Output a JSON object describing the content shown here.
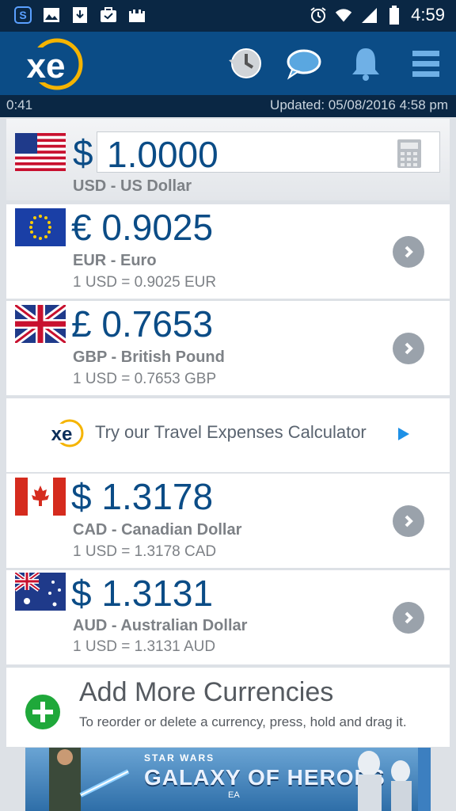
{
  "status_bar": {
    "time": "4:59",
    "left_icons": [
      "s-app-icon",
      "image-icon",
      "download-icon",
      "briefcase-icon",
      "castle-icon"
    ],
    "right_icons": [
      "alarm-icon",
      "wifi-icon",
      "signal-icon",
      "battery-icon"
    ]
  },
  "app_bar": {
    "logo": "xe",
    "icons": [
      "history-icon",
      "chat-icon",
      "bell-icon",
      "menu-icon"
    ]
  },
  "update_strip": {
    "elapsed": "0:41",
    "updated": "Updated:  05/08/2016 4:58 pm"
  },
  "base_currency": {
    "symbol": "$",
    "amount": "1.0000",
    "name": "USD - US Dollar"
  },
  "currencies": [
    {
      "symbol": "€",
      "amount": "0.9025",
      "name": "EUR - Euro",
      "rate": "1 USD = 0.9025 EUR"
    },
    {
      "symbol": "£",
      "amount": "0.7653",
      "name": "GBP - British Pound",
      "rate": "1 USD = 0.7653 GBP"
    },
    {
      "symbol": "$",
      "amount": "1.3178",
      "name": "CAD - Canadian Dollar",
      "rate": "1 USD = 1.3178 CAD"
    },
    {
      "symbol": "$",
      "amount": "1.3131",
      "name": "AUD - Australian Dollar",
      "rate": "1 USD = 1.3131 AUD"
    }
  ],
  "promo": {
    "logo": "xe",
    "text": "Try our Travel Expenses Calculator"
  },
  "add_more": {
    "title": "Add More Currencies",
    "hint": "To reorder or delete a currency, press, hold and drag it."
  },
  "ad": {
    "line1": "STAR WARS",
    "line2": "GALAXY OF HEROES",
    "line3": "EA"
  },
  "colors": {
    "brand_blue": "#0b4c86",
    "dark_navy": "#0a2744",
    "accent_yellow": "#f5b400",
    "add_green": "#1fa83a"
  }
}
